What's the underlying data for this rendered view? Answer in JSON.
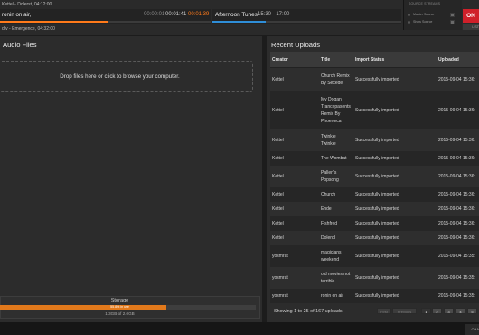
{
  "topbar": {
    "previous": "Kettel - Dolerst, 04:12:00",
    "now_playing": "ronin on air,",
    "elapsed": "00:00:01",
    "total": "00:01:41",
    "remaining": "00:01:39",
    "track_progress": 0.51,
    "next": "dtv - Emergence, 04:32:00",
    "show_name": "Afternoon Tunes",
    "show_time": "15:30 - 17:00",
    "show_progress": 0.28,
    "accent_color": "#ff7a1a",
    "show_color": "#2f8ed8"
  },
  "source_streams": {
    "title": "SOURCE STREAMS",
    "items": [
      {
        "label": "Master Source"
      },
      {
        "label": "Show Source"
      }
    ],
    "on_air_label": "ON",
    "listen_label": "LIST"
  },
  "audio_files": {
    "heading": "Audio Files",
    "dropzone_text": "Drop files here or click to browse your computer."
  },
  "storage": {
    "label": "Storage",
    "percent_text": "55.8% in use",
    "used_text": "1.3GB of 2.0GB",
    "used_fraction": 0.65
  },
  "recent_uploads": {
    "heading": "Recent Uploads",
    "columns": [
      "Creator",
      "Title",
      "Import Status",
      "Uploaded"
    ],
    "rows": [
      {
        "creator": "Kettel",
        "title": "Church Remix By Secede",
        "status": "Successfully imported",
        "uploaded": "2015-09-04 15:36:"
      },
      {
        "creator": "Kettel",
        "title": "My Dogan Trancepasents Remix By Phoeneca",
        "status": "Successfully imported",
        "uploaded": "2015-09-04 15:36:"
      },
      {
        "creator": "Kettel",
        "title": "Twinkle Twinkle",
        "status": "Successfully imported",
        "uploaded": "2015-09-04 15:36:"
      },
      {
        "creator": "Kettel",
        "title": "The Wombat",
        "status": "Successfully imported",
        "uploaded": "2015-09-04 15:36:"
      },
      {
        "creator": "Kettel",
        "title": "Pallen's Popsong",
        "status": "Successfully imported",
        "uploaded": "2015-09-04 15:36:"
      },
      {
        "creator": "Kettel",
        "title": "Church",
        "status": "Successfully imported",
        "uploaded": "2015-09-04 15:36:"
      },
      {
        "creator": "Kettel",
        "title": "Ende",
        "status": "Successfully imported",
        "uploaded": "2015-09-04 15:36:"
      },
      {
        "creator": "Kettel",
        "title": "Fishfred",
        "status": "Successfully imported",
        "uploaded": "2015-09-04 15:36:"
      },
      {
        "creator": "Kettel",
        "title": "Dolend",
        "status": "Successfully imported",
        "uploaded": "2015-09-04 15:36:"
      },
      {
        "creator": "yosmrat",
        "title": "magicians weekend",
        "status": "Successfully imported",
        "uploaded": "2015-09-04 15:35:"
      },
      {
        "creator": "yosmrat",
        "title": "old movies not terrible",
        "status": "Successfully imported",
        "uploaded": "2015-09-04 15:35:"
      },
      {
        "creator": "yosmrat",
        "title": "ronin on air",
        "status": "Successfully imported",
        "uploaded": "2015-09-04 15:35:"
      }
    ],
    "footer": "Showing 1 to 25 of 167 uploads",
    "pagination": {
      "first": "First",
      "previous": "Previous",
      "pages": [
        "1",
        "2",
        "3",
        "4",
        "5"
      ]
    }
  },
  "bottom": {
    "chat_label": "CHA"
  }
}
